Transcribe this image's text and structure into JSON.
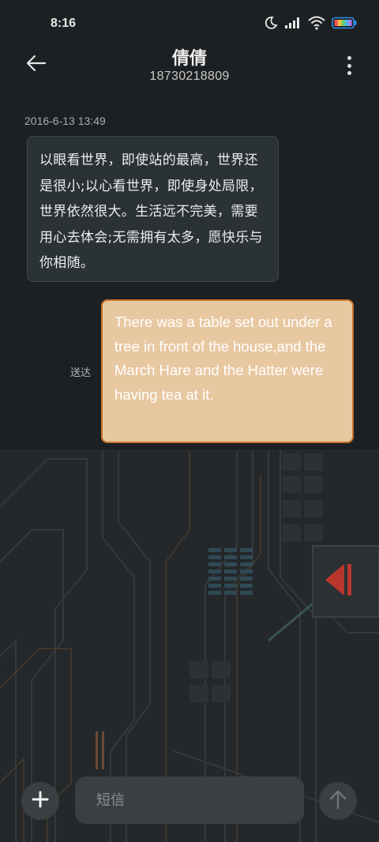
{
  "status_bar": {
    "time": "8:16",
    "icons": [
      "moon-icon",
      "signal-icon",
      "wifi-icon",
      "battery-icon"
    ]
  },
  "header": {
    "contact_name": "倩倩",
    "phone_number": "18730218809",
    "back_icon": "arrow-left-icon",
    "menu_icon": "more-vertical-icon"
  },
  "conversation": {
    "timestamp": "2016-6-13 13:49",
    "messages": [
      {
        "direction": "incoming",
        "text": "以眼看世界，即使站的最高，世界还是很小;以心看世界，即使身处局限，世界依然很大。生活远不完美，需要用心去体会;无需拥有太多，愿快乐与你相随。"
      },
      {
        "direction": "outgoing",
        "status": "送达",
        "text": "There was a table set out under a tree in front of the house,and the March Hare and the Hatter were having tea at it."
      }
    ]
  },
  "composer": {
    "placeholder": "短信",
    "value": "",
    "add_icon": "plus-icon",
    "send_icon": "arrow-up-icon"
  },
  "colors": {
    "background": "#1d2022",
    "incoming_bubble": "#2b3236",
    "outgoing_bubble": "#e8c8a1",
    "outgoing_border": "#c9752f",
    "circuit_accent": "#c0392b"
  }
}
